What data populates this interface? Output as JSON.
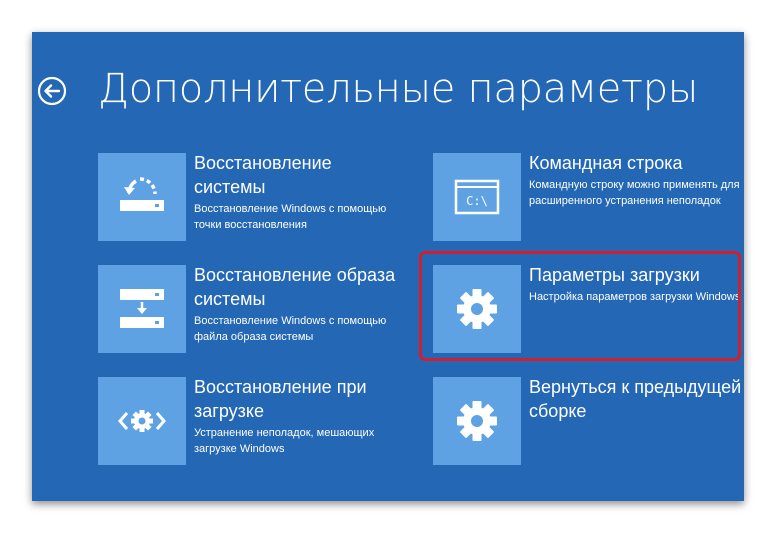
{
  "page_title": "Дополнительные параметры",
  "icons": {
    "back": "back-arrow-icon"
  },
  "colors": {
    "background": "#2367b5",
    "tile": "#5fa2e3",
    "highlight": "#d0202e",
    "text": "#ffffff"
  },
  "tiles": [
    {
      "id": "system-restore",
      "title": "Восстановление системы",
      "desc": "Восстановление Windows с помощью точки восстановления",
      "icon": "restore-icon"
    },
    {
      "id": "command-prompt",
      "title": "Командная строка",
      "desc": "Командную строку можно применять для расширенного устранения неполадок",
      "icon": "command-prompt-icon"
    },
    {
      "id": "system-image-recovery",
      "title": "Восстановление образа системы",
      "desc": "Восстановление Windows с помощью файла образа системы",
      "icon": "image-recovery-icon"
    },
    {
      "id": "startup-settings",
      "title": "Параметры загрузки",
      "desc": "Настройка параметров загрузки Windows",
      "icon": "gear-icon",
      "highlighted": true
    },
    {
      "id": "startup-repair",
      "title": "Восстановление при загрузке",
      "desc": "Устранение неполадок, мешающих загрузке Windows",
      "icon": "startup-repair-icon"
    },
    {
      "id": "previous-build",
      "title": "Вернуться к предыдущей сборке",
      "desc": "",
      "icon": "gear-icon"
    }
  ]
}
